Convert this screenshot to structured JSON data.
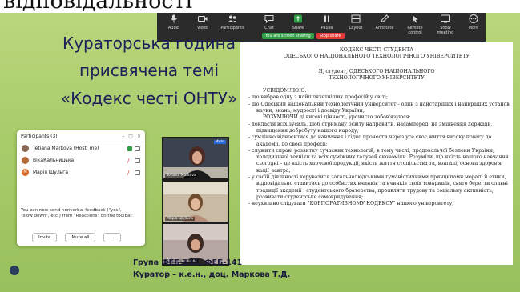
{
  "top_text": "відповідальності.",
  "toolbar": {
    "buttons": [
      {
        "label": "Audio",
        "icon": "mic-icon"
      },
      {
        "label": "Video",
        "icon": "camera-icon"
      },
      {
        "label": "Participants",
        "icon": "people-icon"
      },
      {
        "label": "Chat",
        "icon": "chat-icon"
      },
      {
        "label": "Share",
        "icon": "share-icon"
      },
      {
        "label": "Pause",
        "icon": "pause-icon"
      },
      {
        "label": "Layout",
        "icon": "layout-icon"
      },
      {
        "label": "Annotate",
        "icon": "annotate-icon"
      },
      {
        "label": "Remote control",
        "icon": "remote-control-icon"
      },
      {
        "label": "Show meeting",
        "icon": "show-meeting-icon"
      },
      {
        "label": "More",
        "icon": "more-icon"
      }
    ],
    "sharing_status": "You are screen sharing",
    "stop_share": "Stop share",
    "colors": {
      "background": "#2b2b2b",
      "sharing_status": "#2f9e44",
      "stop_share": "#e53935"
    }
  },
  "slide": {
    "title_lines": [
      "Кураторська година",
      "присвячена темі",
      "«Кодекс честі ОНТУ»"
    ],
    "group_text": "Група ФЕБ-131, ФЕБ-141",
    "curator_text": "Куратор – к.е.н., доц. Маркова Т.Д."
  },
  "participants": {
    "title": "Participants (3)",
    "rows": [
      {
        "name": "Tetiana Markova (Host, me)",
        "avatar_color": "#8a6a55"
      },
      {
        "name": "ВікаКальницька",
        "avatar_color": "#b56a3a"
      },
      {
        "name": "Марія Шульга",
        "avatar_color": "#d96b2a",
        "initial": "М"
      }
    ],
    "note": "You can now send nonverbal feedback (\"yes\", \"slow down\", etc.) from \"Reactions\" on the toolbar.",
    "invite_label": "Invite",
    "mute_all_label": "Mute all",
    "more_label": "..."
  },
  "videos": {
    "tiles": [
      {
        "label": "Tetiana Markova",
        "badge": "Mute"
      },
      {
        "label": "Марія Шульга"
      },
      {
        "label": "ВікаКальницька"
      }
    ]
  },
  "document": {
    "title_lines": [
      "КОДЕКС ЧЕСТІ СТУДЕНТА",
      "ОДЕСЬКОГО НАЦІОНАЛЬНОГО ТЕХНОЛОГІЧНОГО УНІВЕРСИТЕТУ"
    ],
    "intro_lines": [
      "Я, студент, ОДЕСЬКОГО НАЦІОНАЛЬНОГО",
      "ТЕХНОЛОГІЧНОГО УНІВЕРСИТЕТУ"
    ],
    "usvidomlyuyu": "УСВІДОМЛЮЮ:",
    "items_a": [
      "- що вибрав одну з найшляхетніших професій у світі;",
      "- що Одеський національний технологічний університет - один з найстаріших і найкращих установ науки, знань, мудрості і досвіду України;"
    ],
    "rozumiyuchy": "РОЗУМІЮЧИ ці високі цінності, урочисто зобов'язуюся:",
    "items_b": [
      "- докласти всіх зусиль, щоб отриману освіту направити, насамперед, на зміцнення держави, підвищення добробуту нашого народу;",
      "- сумлінно відноситися до навчання і гідно пронести через усе своє життя високу повагу до академії, до своєї професії;",
      "- служити справі розвитку сучасних технологій, в тому числі, продовольчої безпеки України, холодильної техніки та всіх суміжних галузей економіки. Розуміти, що якість нашого навчання сьогодні – це якість харчової продукції, якість життя суспільства та, взагалі, основа здоров'я нації_завтра;",
      "- у своїй діяльності керуватися загальнолюдськими гуманістичними принципами моралі й етики, відповідально ставитись до особистих вчинків та вчинків своїх товаришів, свято берегти славні традиції академії і студентського братерства, проявляти трудову та соціальну активність, розвивати студентське самоврядування;"
    ],
    "last_item": "- неухильно слідувати \"КОРПОРАТИВНОМУ КОДЕКСУ\" нашого університету;"
  }
}
